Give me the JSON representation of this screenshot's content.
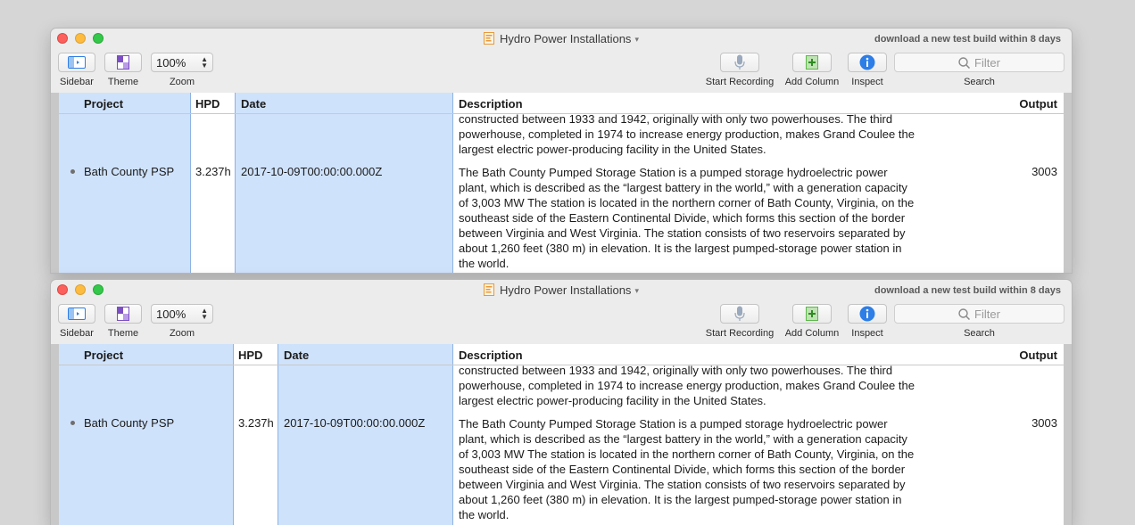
{
  "window": {
    "title": "Hydro Power Installations",
    "notice": "download a new test build within 8 days"
  },
  "toolbar": {
    "sidebar_label": "Sidebar",
    "theme_label": "Theme",
    "zoom_label": "Zoom",
    "zoom_value": "100%",
    "start_recording_label": "Start Recording",
    "add_column_label": "Add Column",
    "inspect_label": "Inspect",
    "search_label": "Search",
    "search_placeholder": "Filter"
  },
  "table": {
    "columns": [
      "Project",
      "HPD",
      "Date",
      "Description",
      "Output"
    ],
    "prev_description_tail": "constructed between 1933 and 1942, originally with only two powerhouses. The third powerhouse, completed in 1974 to increase energy production, makes Grand Coulee the largest electric power-producing facility in the United States.",
    "row": {
      "project": "Bath County PSP",
      "hpd": "3.237h",
      "date": "2017-10-09T00:00:00.000Z",
      "description": "The Bath County Pumped Storage Station is a pumped storage hydroelectric power plant, which is described as the “largest battery in the world,” with a generation capacity of 3,003 MW The station is located in the northern corner of Bath County, Virginia, on the southeast side of the Eastern Continental Divide, which forms this section of the border between Virginia and West Virginia. The station consists of two reservoirs separated by about 1,260 feet (380 m) in elevation. It is the largest pumped-storage power station in the world.",
      "output": "3003"
    }
  },
  "icons": {
    "sidebar": "sidebar-icon",
    "theme": "theme-icon",
    "microphone": "microphone-icon",
    "add_column": "add-column-icon",
    "inspect": "info-icon",
    "search": "search-icon",
    "document": "document-icon"
  },
  "colors": {
    "selection_column": "#cfe2fb",
    "column_divider": "#8db3e2",
    "inspect_blue": "#2d7ee6",
    "add_green": "#5db84a"
  }
}
